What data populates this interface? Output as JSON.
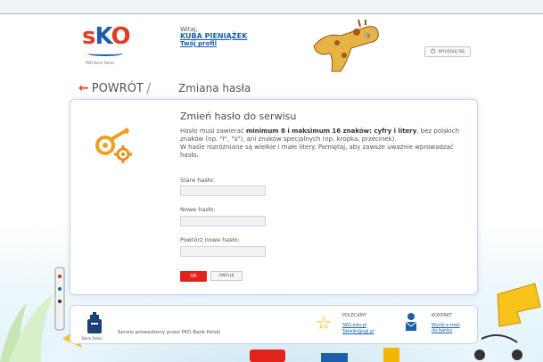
{
  "header": {
    "logo_text_s": "s",
    "logo_text_k": "K",
    "logo_text_o": "O",
    "logo_sub": "PKO Bank Polski",
    "greeting_line1": "Witaj,",
    "user_name": "KUBA PIENIĄŻEK",
    "profile_link": "Twój profil",
    "logout_label": "WYLOGUJ SIĘ",
    "logout_icon": "power-icon"
  },
  "nav": {
    "back_label": "POWRÓT",
    "separator": "/",
    "page_title": "Zmiana hasła"
  },
  "form": {
    "title": "Zmień hasło do serwisu",
    "rule_prefix": "Hasło musi zawierać ",
    "rule_bold": "minimum 8 i maksimum 16 znaków: cyfry i litery",
    "rule_suffix": ", bez polskich znaków (np. \"ł\", \"ś\"), ani znaków specjalnych (np. kropka, przecinek).",
    "rule_case": "W haśle rozróżniane są wielkie i małe litery. Pamiętaj, aby zawsze uważnie wprowadzać hasło.",
    "old_password_label": "Stare hasło:",
    "old_password_value": "",
    "new_password_label": "Nowe hasło:",
    "new_password_value": "",
    "repeat_password_label": "Powtórz nowe hasło:",
    "repeat_password_value": "",
    "ok_label": "OK",
    "cancel_label": "ANULUJ"
  },
  "footer": {
    "bank_label": "Bank Polski",
    "service_text": "Serwis prowadzony przez PKO Bank Polski",
    "recommend_title": "POLECAMY",
    "recommend_links": [
      "SKO.edu.pl",
      "Tabelki@sgl.pl"
    ],
    "contact_title": "KONTAKT",
    "contact_links": [
      "Wyślij e-mail",
      "do banku"
    ]
  },
  "colors": {
    "accent_red": "#e2231a",
    "link_blue": "#1c5fa8",
    "star_yellow": "#f2b600"
  }
}
